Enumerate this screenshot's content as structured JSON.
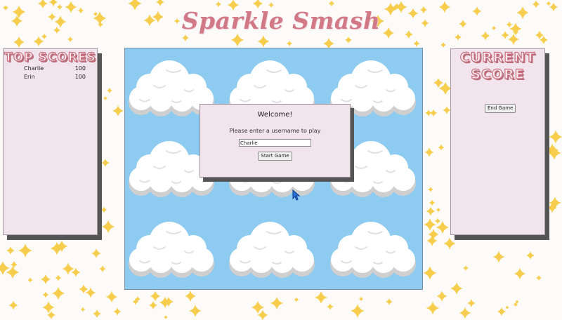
{
  "game": {
    "title": "Sparkle Smash"
  },
  "top_scores": {
    "heading": "Top Scores",
    "entries": [
      {
        "name": "Charlie",
        "score": "100"
      },
      {
        "name": "Erin",
        "score": "100"
      }
    ]
  },
  "current_score": {
    "heading_line1": "Current",
    "heading_line2": "Score",
    "end_game_label": "End Game"
  },
  "welcome_dialog": {
    "title": "Welcome!",
    "prompt": "Please enter a username to play",
    "username_value": "Charlie",
    "start_button_label": "Start Game"
  },
  "colors": {
    "title_pink": "#d27988",
    "panel_bg": "#f1e4ec",
    "sky_blue": "#8ecbf0",
    "star_yellow": "#f6cd4c"
  },
  "icons": [
    "sparkle-star-icon",
    "cloud-icon",
    "mouse-cursor-icon"
  ]
}
